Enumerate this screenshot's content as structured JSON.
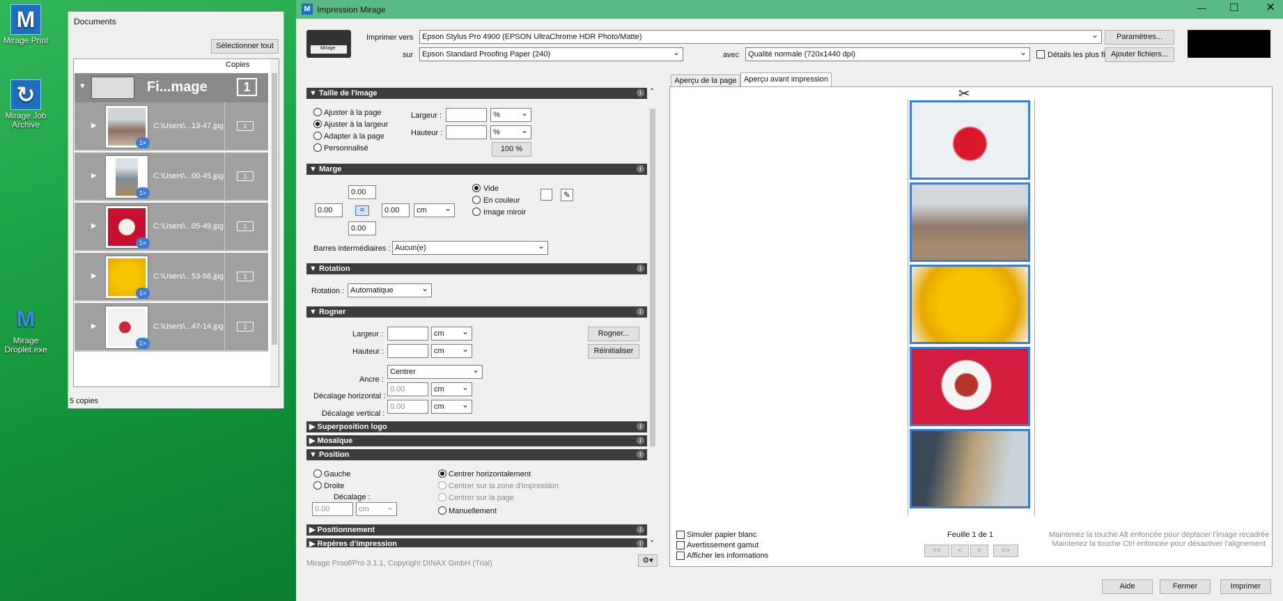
{
  "desktop": {
    "icons": [
      {
        "label": "Mirage Print"
      },
      {
        "label": "Mirage Job Archive"
      },
      {
        "label": "Mirage Droplet.exe"
      }
    ]
  },
  "documents": {
    "title": "Documents",
    "select_all": "Sélectionner tout",
    "copies_header": "Copies",
    "group_name": "Fi...mage",
    "group_count": "1",
    "rows": [
      {
        "path": "C:\\Users\\...13-47.jpg",
        "count": "1",
        "badge": "1×"
      },
      {
        "path": "C:\\Users\\...00-45.jpg",
        "count": "1",
        "badge": "1×"
      },
      {
        "path": "C:\\Users\\...05-49.jpg",
        "count": "1",
        "badge": "1×"
      },
      {
        "path": "C:\\Users\\...53-58.jpg",
        "count": "1",
        "badge": "1×"
      },
      {
        "path": "C:\\Users\\...47-14.jpg",
        "count": "1",
        "badge": "1×"
      }
    ],
    "footer": "5 copies"
  },
  "window": {
    "title": "Impression Mirage",
    "printer_label": "Imprimer vers",
    "printer": "Epson Stylus Pro 4900 (EPSON UltraChrome HDR Photo/Matte)",
    "paper_label": "sur",
    "paper": "Epson Standard Proofing Paper (240)",
    "quality_label": "avec",
    "quality": "Qualité normale (720x1440 dpi)",
    "fine_detail": "Détails les plus fins",
    "params_btn": "Paramètres...",
    "add_files_btn": "Ajouter fichiers...",
    "printer_tag": "Mirage"
  },
  "sections": {
    "size": {
      "title": "Taille de l'image",
      "options": [
        "Ajuster à la page",
        "Ajuster à la largeur",
        "Adapter à la page",
        "Personnalisé"
      ],
      "width_label": "Largeur :",
      "height_label": "Hauteur :",
      "unit": "%",
      "unit2": "%",
      "scale": "100 %"
    },
    "margin": {
      "title": "Marge",
      "top": "0.00",
      "left": "0.00",
      "right": "0.00",
      "bottom": "0.00",
      "equal": "=",
      "unit": "cm",
      "opts": [
        "Vide",
        "En couleur",
        "Image miroir"
      ],
      "bars_label": "Barres intermédiaires :",
      "bars_value": "Aucun(e)"
    },
    "rotation": {
      "title": "Rotation",
      "label": "Rotation :",
      "value": "Automatique"
    },
    "crop": {
      "title": "Rogner",
      "width_label": "Largeur :",
      "height_label": "Hauteur :",
      "unit": "cm",
      "unit2": "cm",
      "crop_btn": "Rogner...",
      "reset_btn": "Réinitialiser",
      "anchor_label": "Ancre :",
      "anchor": "Centrer",
      "hoff_label": "Décalage horizontal :",
      "hoff": "0.00",
      "hunit": "cm",
      "voff_label": "Décalage vertical :",
      "voff": "0.00",
      "vunit": "cm"
    },
    "logo": {
      "title": "Superposition logo"
    },
    "mosaic": {
      "title": "Mosaïque"
    },
    "position": {
      "title": "Position",
      "left": "Gauche",
      "right": "Droite",
      "offset_label": "Décalage :",
      "offset": "0.00",
      "offset_unit": "cm",
      "center_h": "Centrer horizontalement",
      "center_print": "Centrer sur la zone d'impression",
      "center_page": "Centrer sur la page",
      "manual": "Manuellement"
    },
    "placement": {
      "title": "Positionnement"
    },
    "marks": {
      "title": "Repères d'impression"
    }
  },
  "copyright": "Mirage Proof/Pro 3.1.1, Copyright DINAX GmbH (Trial)",
  "tabs": [
    "Aperçu de la page",
    "Aperçu avant impression"
  ],
  "preview": {
    "simulate": "Simuler papier blanc",
    "gamut": "Avertissement gamut",
    "show_info": "Afficher les informations",
    "sheet": "Feuille 1 de 1",
    "nav": [
      "<<",
      "<",
      ">",
      ">>"
    ],
    "hint1": "Maintenez la touche Alt enfoncée pour déplacer l'image recadrée",
    "hint2": "Maintenez la touche Ctrl enfoncée pour désactiver l'alignement"
  },
  "buttons": {
    "help": "Aide",
    "close": "Fermer",
    "print": "Imprimer"
  },
  "colors": {
    "accent": "#3a7bd5",
    "titlebar": "#5aba84",
    "section": "#3c3c3c"
  }
}
